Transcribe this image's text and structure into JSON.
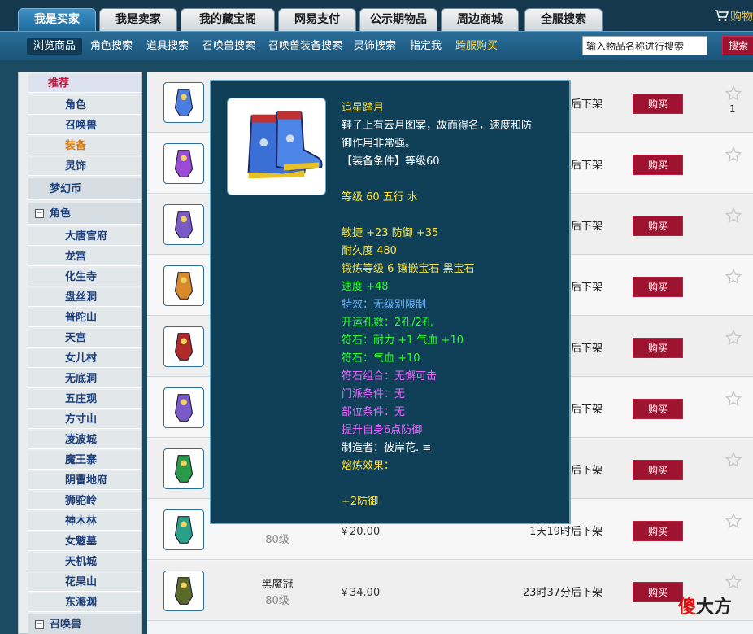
{
  "top_tabs": [
    "我是买家",
    "我是卖家",
    "我的藏宝阁",
    "网易支付",
    "公示期物品",
    "周边商城",
    "全服搜索"
  ],
  "cart_label": "购物",
  "sub_nav": [
    "浏览商品",
    "角色搜索",
    "道具搜索",
    "召唤兽搜索",
    "召唤兽装备搜索",
    "灵饰搜索",
    "指定我",
    "跨服购买"
  ],
  "search": {
    "placeholder": "输入物品名称进行搜索",
    "button": "搜索"
  },
  "sidebar": {
    "recommend": "推荐",
    "recommend_items": [
      "角色",
      "召唤兽",
      "装备",
      "灵饰"
    ],
    "gold": "梦幻币",
    "role_group": "角色",
    "schools": [
      "大唐官府",
      "龙宫",
      "化生寺",
      "盘丝洞",
      "普陀山",
      "天宫",
      "女儿村",
      "无底洞",
      "五庄观",
      "方寸山",
      "凌波城",
      "魔王寨",
      "阴曹地府",
      "狮驼岭",
      "神木林",
      "女魃墓",
      "天机城",
      "花果山",
      "东海渊"
    ],
    "pet_group": "召唤兽",
    "group_toggle": "−"
  },
  "rows": [
    {
      "time": "后下架",
      "buy": "购买",
      "star_count": "1"
    },
    {
      "time": "后下架",
      "buy": "购买"
    },
    {
      "time": "后下架",
      "buy": "购买"
    },
    {
      "time": "后下架",
      "buy": "购买"
    },
    {
      "time": "后下架",
      "buy": "购买"
    },
    {
      "time": "后下架",
      "buy": "购买"
    },
    {
      "time": "后下架",
      "buy": "购买"
    },
    {
      "level": "80级",
      "price": "￥20.00",
      "time": "1天19时后下架",
      "buy": "购买"
    },
    {
      "name": "黑魔冠",
      "level": "80级",
      "price": "￥34.00",
      "time": "23时37分后下架",
      "buy": "购买"
    }
  ],
  "tooltip": {
    "lines": [
      {
        "text": "追星踏月",
        "color": "yellow"
      },
      {
        "text": "鞋子上有云月图案，故而得名，速度和防",
        "color": "white"
      },
      {
        "text": "御作用非常强。",
        "color": "white"
      },
      {
        "text": "【装备条件】等级60",
        "color": "white"
      },
      {
        "text": "",
        "color": "white"
      },
      {
        "text": "等级 60 五行 水",
        "color": "yellow"
      },
      {
        "text": "",
        "color": "white"
      },
      {
        "text": "敏捷 +23 防御 +35",
        "color": "yellow"
      },
      {
        "text": "耐久度 480",
        "color": "yellow"
      },
      {
        "text": "锻炼等级 6 镶嵌宝石 黑宝石",
        "color": "yellow"
      },
      {
        "text": "速度 +48",
        "color": "green"
      },
      {
        "text": "特效：无级别限制",
        "color": "blue"
      },
      {
        "text": "开运孔数：2孔/2孔",
        "color": "green"
      },
      {
        "text": "符石：耐力 +1 气血 +10",
        "color": "green"
      },
      {
        "text": "符石：气血 +10",
        "color": "green"
      },
      {
        "text": "符石组合：无懈可击",
        "color": "purple"
      },
      {
        "text": "门派条件：无",
        "color": "purple"
      },
      {
        "text": "部位条件：无",
        "color": "purple"
      },
      {
        "text": "提升自身6点防御",
        "color": "purple"
      },
      {
        "text": "制造者：彼岸花. ≡",
        "color": "white"
      },
      {
        "text": "熔炼效果：",
        "color": "yellow"
      },
      {
        "text": "",
        "color": "white"
      },
      {
        "text": "+2防御",
        "color": "yellow"
      }
    ]
  },
  "watermark": {
    "red": "傻",
    "rest": "大方"
  },
  "colors": {
    "accent_red": "#9e1430",
    "tooltip_bg": "#0f4058",
    "nav_blue": "#1a557a"
  }
}
